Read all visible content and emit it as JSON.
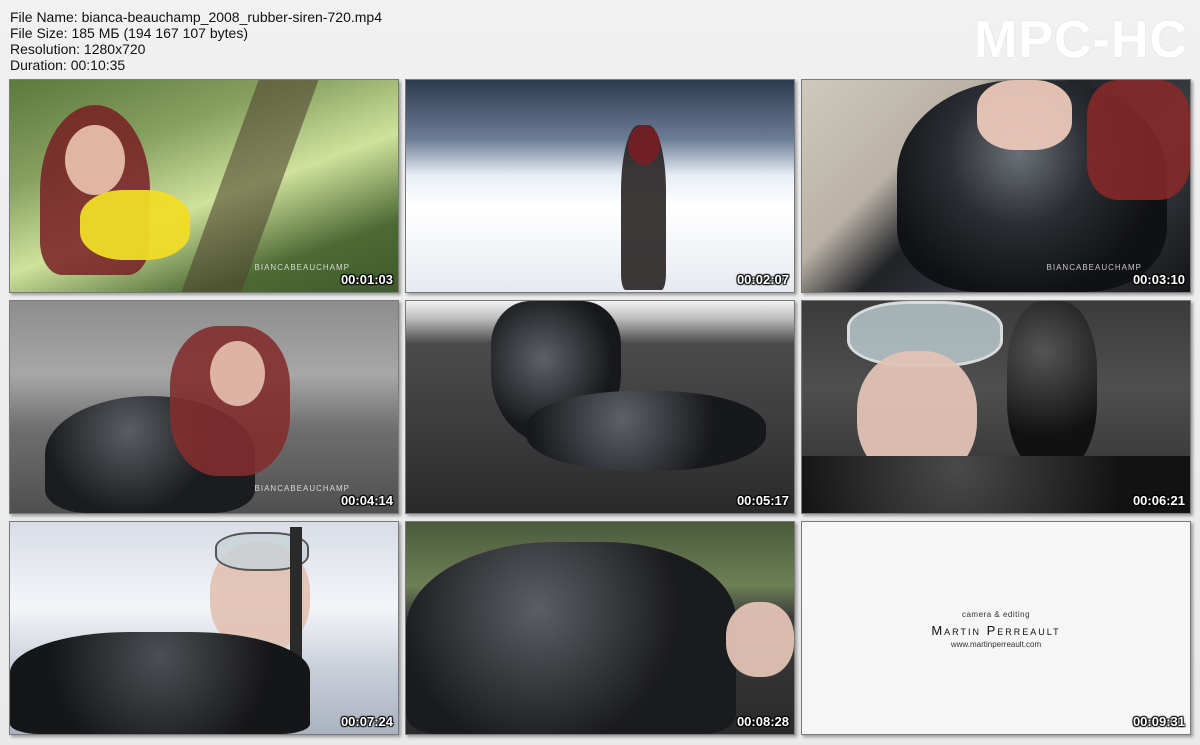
{
  "file_info": {
    "file_name": "File Name: bianca-beauchamp_2008_rubber-siren-720.mp4",
    "file_size": "File Size: 185 МБ (194 167 107 bytes)",
    "resolution": "Resolution: 1280x720",
    "duration": "Duration: 00:10:35"
  },
  "brand": "MPC-HC",
  "thumbnails": [
    {
      "timestamp": "00:01:03",
      "watermark": "BIANCABEAUCHAMP"
    },
    {
      "timestamp": "00:02:07",
      "watermark": ""
    },
    {
      "timestamp": "00:03:10",
      "watermark": "BIANCABEAUCHAMP"
    },
    {
      "timestamp": "00:04:14",
      "watermark": "BIANCABEAUCHAMP"
    },
    {
      "timestamp": "00:05:17",
      "watermark": ""
    },
    {
      "timestamp": "00:06:21",
      "watermark": ""
    },
    {
      "timestamp": "00:07:24",
      "watermark": ""
    },
    {
      "timestamp": "00:08:28",
      "watermark": ""
    },
    {
      "timestamp": "00:09:31",
      "watermark": ""
    }
  ],
  "credits": {
    "role": "camera & editing",
    "name": "Martin Perreault",
    "url": "www.martinperreault.com"
  }
}
